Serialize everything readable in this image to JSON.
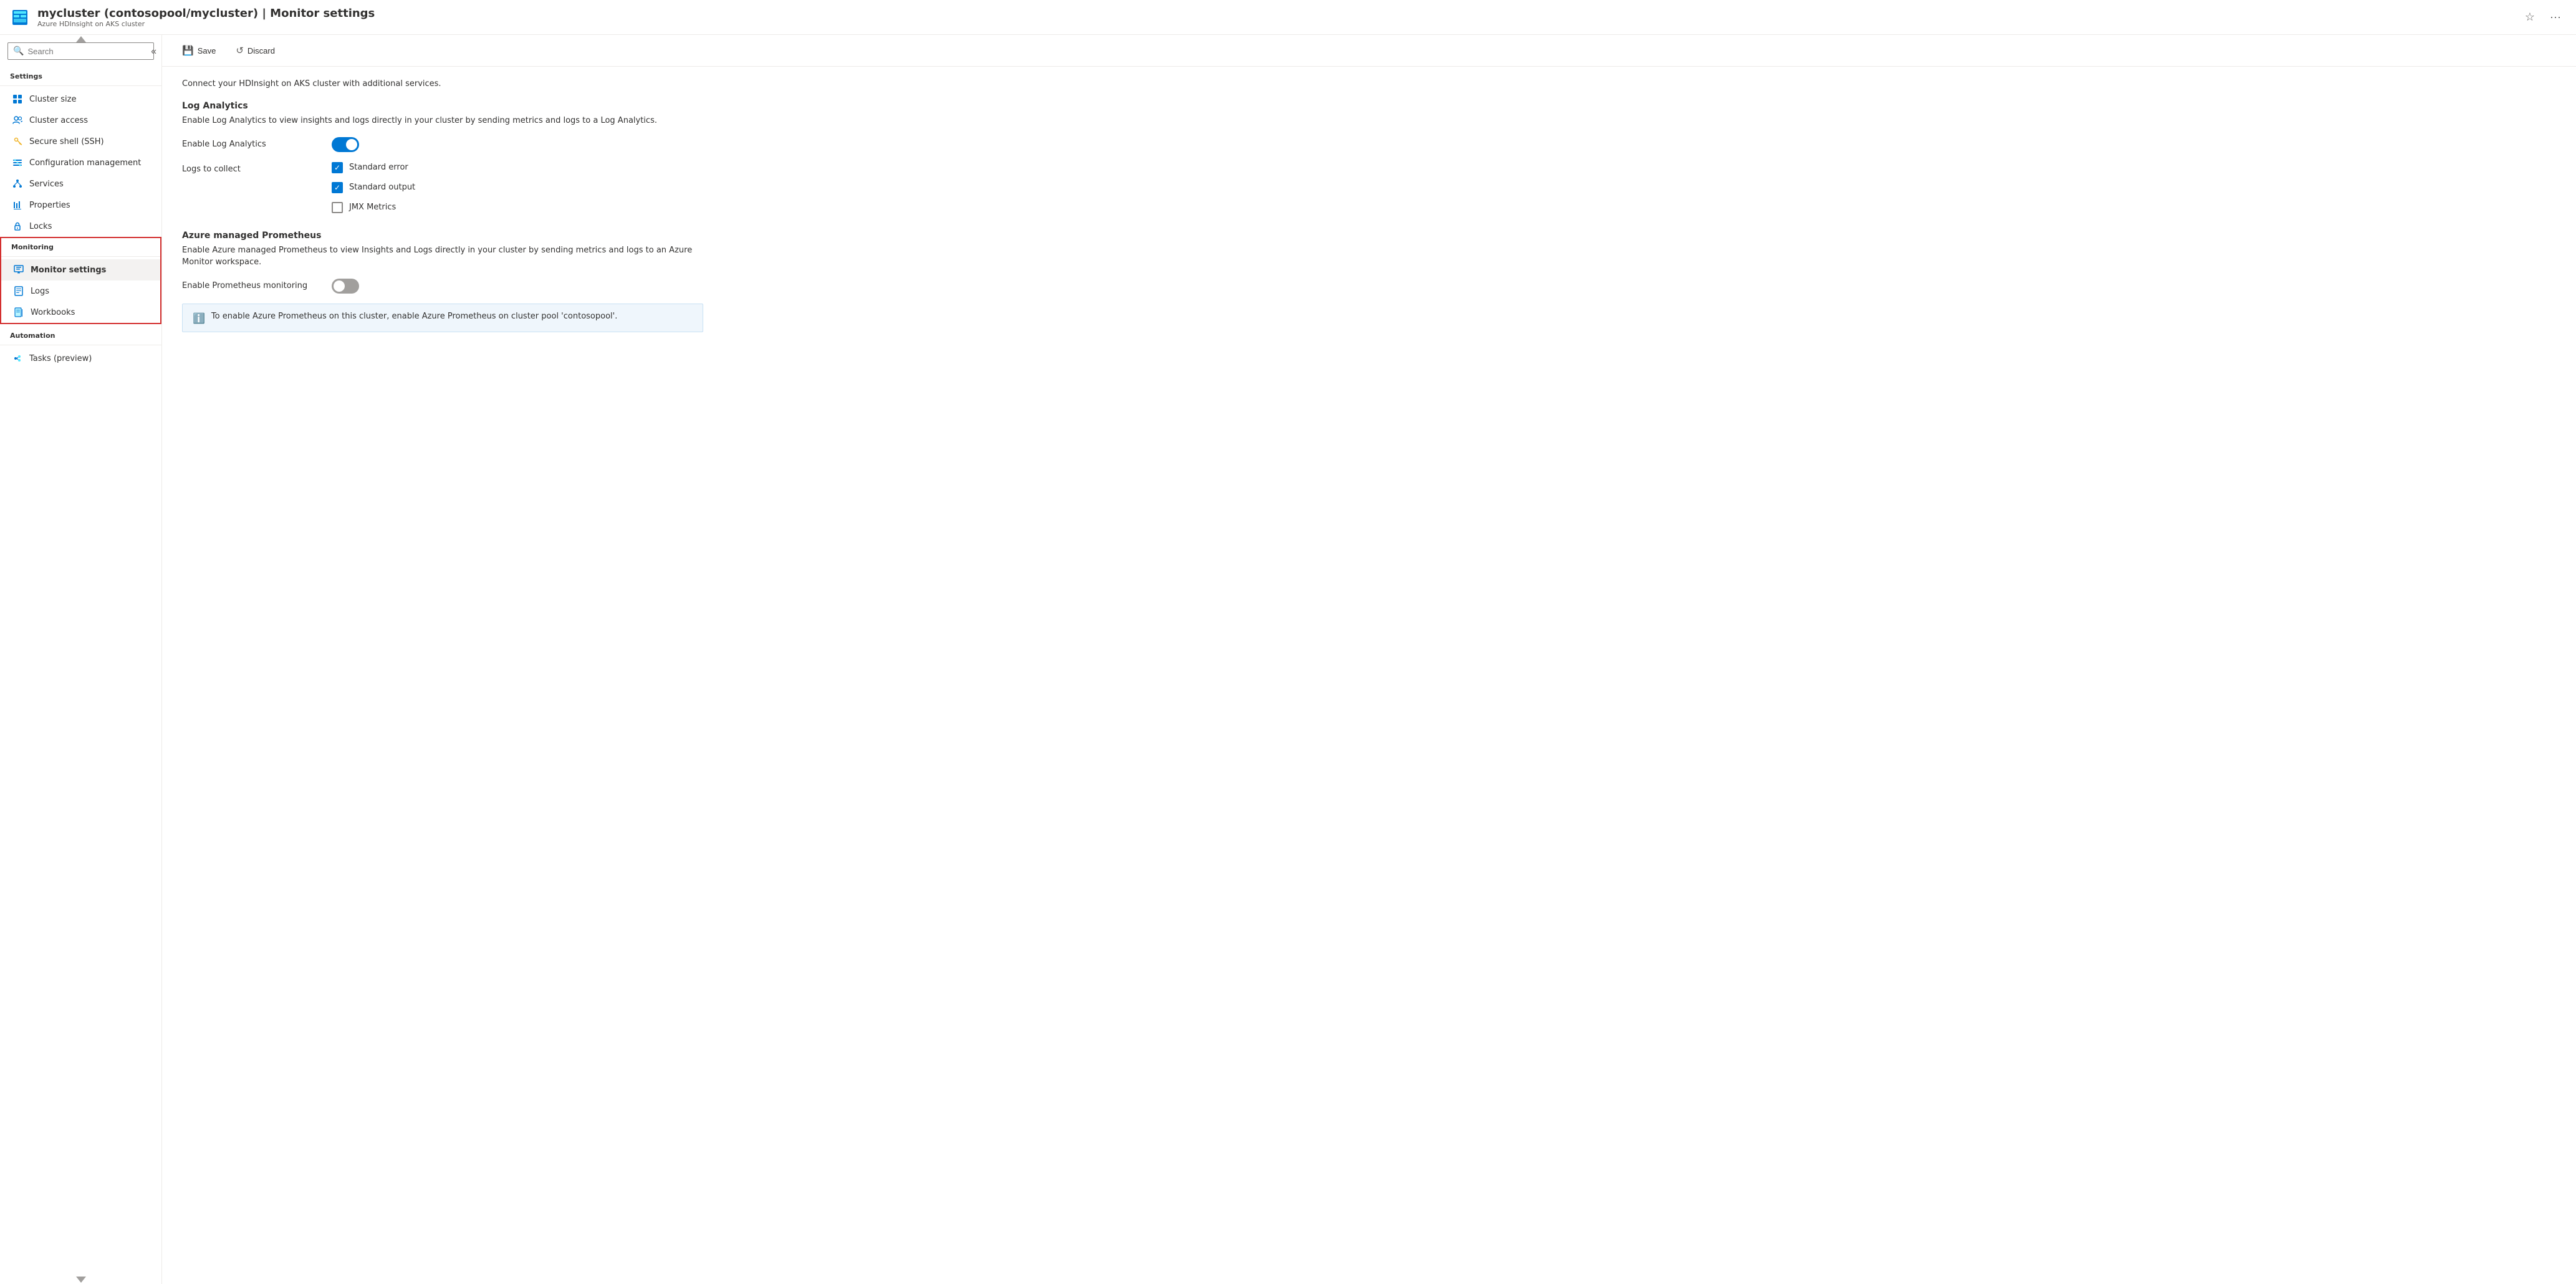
{
  "header": {
    "title": "mycluster (contosopool/mycluster) | Monitor settings",
    "subtitle": "Azure HDInsight on AKS cluster",
    "favorite_label": "☆",
    "more_label": "···"
  },
  "search": {
    "placeholder": "Search"
  },
  "sidebar": {
    "collapse_icon": "«",
    "settings_label": "Settings",
    "items_settings": [
      {
        "id": "cluster-size",
        "label": "Cluster size",
        "icon": "grid"
      },
      {
        "id": "cluster-access",
        "label": "Cluster access",
        "icon": "people"
      },
      {
        "id": "secure-shell",
        "label": "Secure shell (SSH)",
        "icon": "key"
      },
      {
        "id": "configuration-management",
        "label": "Configuration management",
        "icon": "list"
      },
      {
        "id": "services",
        "label": "Services",
        "icon": "nodes"
      },
      {
        "id": "properties",
        "label": "Properties",
        "icon": "bars"
      },
      {
        "id": "locks",
        "label": "Locks",
        "icon": "lock"
      }
    ],
    "monitoring_label": "Monitoring",
    "items_monitoring": [
      {
        "id": "monitor-settings",
        "label": "Monitor settings",
        "icon": "monitor",
        "active": true
      },
      {
        "id": "logs",
        "label": "Logs",
        "icon": "logs"
      },
      {
        "id": "workbooks",
        "label": "Workbooks",
        "icon": "workbooks"
      }
    ],
    "automation_label": "Automation",
    "items_automation": [
      {
        "id": "tasks-preview",
        "label": "Tasks (preview)",
        "icon": "tasks"
      }
    ]
  },
  "toolbar": {
    "save_label": "Save",
    "discard_label": "Discard"
  },
  "content": {
    "description": "Connect your HDInsight on AKS cluster with additional services.",
    "log_analytics": {
      "title": "Log Analytics",
      "description": "Enable Log Analytics to view insights and logs directly in your cluster by sending metrics and logs to a Log Analytics.",
      "enable_label": "Enable Log Analytics",
      "enable_state": true,
      "logs_label": "Logs to collect",
      "checkboxes": [
        {
          "id": "standard-error",
          "label": "Standard error",
          "checked": true
        },
        {
          "id": "standard-output",
          "label": "Standard output",
          "checked": true
        },
        {
          "id": "jmx-metrics",
          "label": "JMX Metrics",
          "checked": false
        }
      ]
    },
    "azure_prometheus": {
      "title": "Azure managed Prometheus",
      "description": "Enable Azure managed Prometheus to view Insights and Logs directly in your cluster by sending metrics and logs to an Azure Monitor workspace.",
      "enable_label": "Enable Prometheus monitoring",
      "enable_state": false,
      "info_text": "To enable Azure Prometheus on this cluster, enable Azure Prometheus on cluster pool 'contosopool'."
    }
  }
}
